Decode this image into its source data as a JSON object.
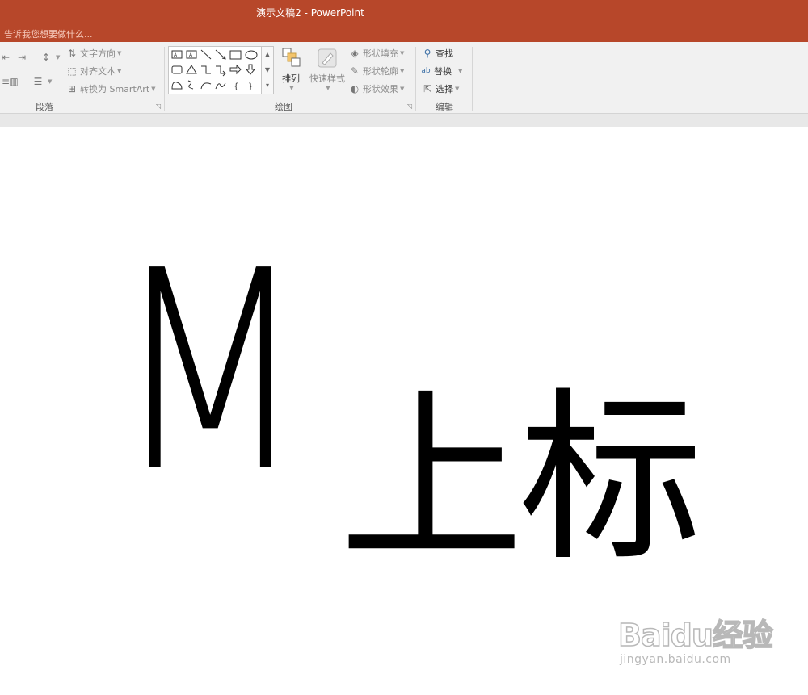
{
  "window": {
    "title": "演示文稿2 - PowerPoint",
    "tell_me": "告诉我您想要做什么..."
  },
  "ribbon": {
    "paragraph": {
      "label": "段落",
      "text_direction": "文字方向",
      "align_text": "对齐文本",
      "convert_smartart": "转换为 SmartArt"
    },
    "drawing": {
      "label": "绘图",
      "arrange": "排列",
      "quick_styles": "快速样式",
      "shape_fill": "形状填充",
      "shape_outline": "形状轮廓",
      "shape_effects": "形状效果"
    },
    "editing": {
      "label": "编辑",
      "find": "查找",
      "replace": "替换",
      "select": "选择"
    }
  },
  "slide": {
    "main_text": "M",
    "subscript_text": "上标"
  },
  "watermark": {
    "logo": "Baidu经验",
    "url": "jingyan.baidu.com"
  },
  "colors": {
    "accent": "#b7472a",
    "ribbon_bg": "#f1f1f1"
  }
}
